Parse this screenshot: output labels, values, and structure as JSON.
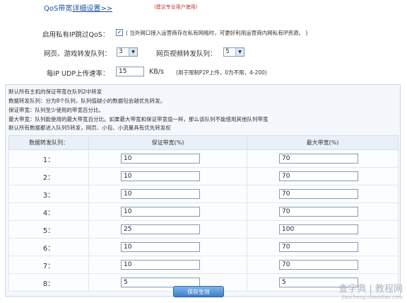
{
  "qos": {
    "title_prefix": "QoS带宽",
    "detail_link": "详细设置>>",
    "pro_note": "(建议专业用户使用)"
  },
  "private_ip": {
    "label": "启用私有IP跳过QoS：",
    "checked": true,
    "note": "( 当外网口接入运营商存在私有网络时，可更好利用运营商内网私有IP资源。 )"
  },
  "queues": {
    "web_game_label": "网页、游戏转发队列：",
    "web_game_value": "3",
    "video_label": "网页视频转发队列：",
    "video_value": "5"
  },
  "udp": {
    "label": "每IP UDP上传速率：",
    "value": "15",
    "unit": "KB/s",
    "note": "(用于限制P2P上传，0为不限，4-200)"
  },
  "description": [
    "默认所有主机的保证带宽在队列2中转发",
    "数据转发队列：分为8个队列，队列值越小的数据包会越优先转发。",
    "保证带宽：队列至少使用的带宽百分比。",
    "最大带宽：队列能使用的最大带宽百分比。如果最大带宽和保证带宽值一样，那么该队列不能借用其他队列带宽",
    "默认所有数据都进入队列5转发，网页、小包、小流量具有优先转发权"
  ],
  "table": {
    "headers": [
      "数据转发队列：",
      "保证带宽(%)",
      "最大带宽(%)"
    ],
    "rows": [
      {
        "queue": "1：",
        "guaranteed": "10",
        "max": "70"
      },
      {
        "queue": "2：",
        "guaranteed": "10",
        "max": "70"
      },
      {
        "queue": "3：",
        "guaranteed": "10",
        "max": "70"
      },
      {
        "queue": "4：",
        "guaranteed": "10",
        "max": "70"
      },
      {
        "queue": "5：",
        "guaranteed": "25",
        "max": "100"
      },
      {
        "queue": "6：",
        "guaranteed": "10",
        "max": "70"
      },
      {
        "queue": "7：",
        "guaranteed": "10",
        "max": "70"
      },
      {
        "queue": "8：",
        "guaranteed": "5",
        "max": "5"
      }
    ]
  },
  "save_label": "保存生效",
  "watermark": {
    "main": "查字典 | 教程网",
    "sub": "jiaocheng.chazidian.com"
  }
}
